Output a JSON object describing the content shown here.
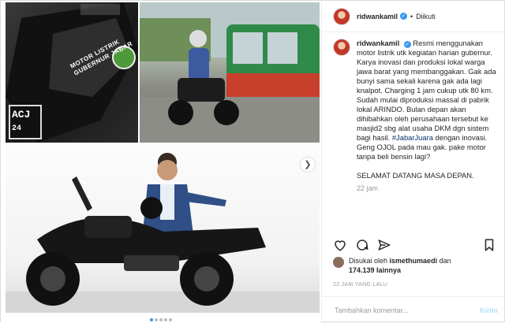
{
  "post": {
    "username": "ridwankamil",
    "follow_state": "Diikuti",
    "verified": true,
    "caption_user": "ridwankamil",
    "caption": "Resmi menggunakan motor listrik utk kegiatan harian gubernur. Karya inovasi dan produksi lokal warga jawa barat yang membanggakan. Gak ada bunyi sama sekali karena gak ada lagi knalpot. Charging 1 jam cukup utk 80 km. Sudah mulai diproduksi massal di pabrik lokal ARINDO. Bulan depan akan dihibahkan oleh perusahaan tersebut ke masjid2 sbg alat usaha DKM dgn sistem bagi hasil. ",
    "caption_tag": "#JabarJuara",
    "caption_rest": " dengan inovasi. Geng OJOL pada mau gak. pake motor tanpa beli bensin lagi?\n\nSELAMAT DATANG MASA DEPAN.",
    "caption_time": "22 jam",
    "likes_prefix": "Disukai oleh",
    "likes_user": "ismethumaedi",
    "likes_and": "dan",
    "likes_count": "174.139 lainnya",
    "date": "22 JAM YANG LALU",
    "comment_placeholder": "Tambahkan komentar...",
    "post_label": "Kirim"
  },
  "media": {
    "plate_number": "ACJ",
    "plate_sub": "24",
    "bike_decal": "MOTOR LISTRIK GUBERNUR JABAR",
    "carousel_count": 5,
    "carousel_active": 0
  },
  "icons": [
    "heart-icon",
    "comment-icon",
    "share-icon",
    "bookmark-icon",
    "chevron-right-icon",
    "verified-icon"
  ],
  "colors": {
    "accent": "#3897f0",
    "text": "#262626",
    "muted": "#999999",
    "tag": "#003569"
  }
}
